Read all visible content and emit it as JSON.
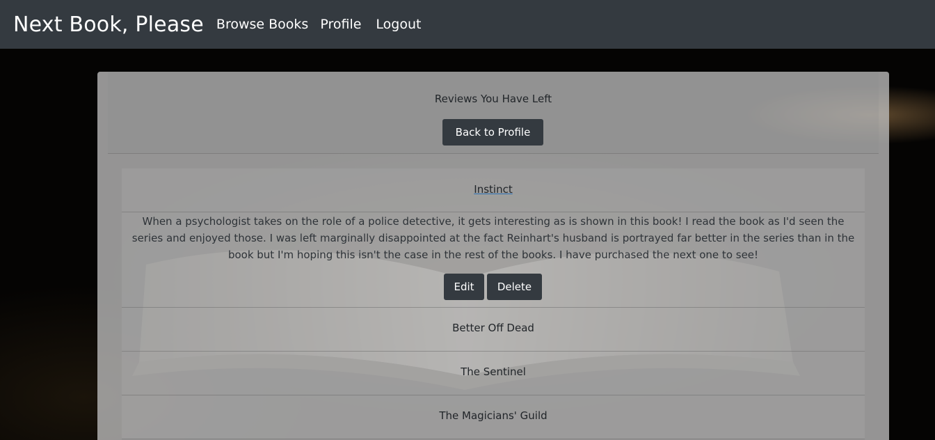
{
  "navbar": {
    "brand": "Next Book, Please",
    "links": {
      "browse": "Browse Books",
      "profile": "Profile",
      "logout": "Logout"
    }
  },
  "card": {
    "title": "Reviews You Have Left",
    "back_button": "Back to Profile"
  },
  "reviews": [
    {
      "title": "Instinct",
      "text": "When a psychologist takes on the role of a police detective, it gets interesting as is shown in this book! I read the book as I'd seen the series and enjoyed those. I was left marginally disappointed at the fact Reinhart's husband is portrayed far better in the series than in the book but I'm hoping this isn't the case in the rest of the books. I have purchased the next one to see!",
      "edit_label": "Edit",
      "delete_label": "Delete"
    },
    {
      "title": "Better Off Dead"
    },
    {
      "title": "The Sentinel"
    },
    {
      "title": "The Magicians' Guild"
    }
  ],
  "colors": {
    "navbar_bg": "#343a40",
    "button_bg": "#343a40",
    "text": "#212529"
  }
}
